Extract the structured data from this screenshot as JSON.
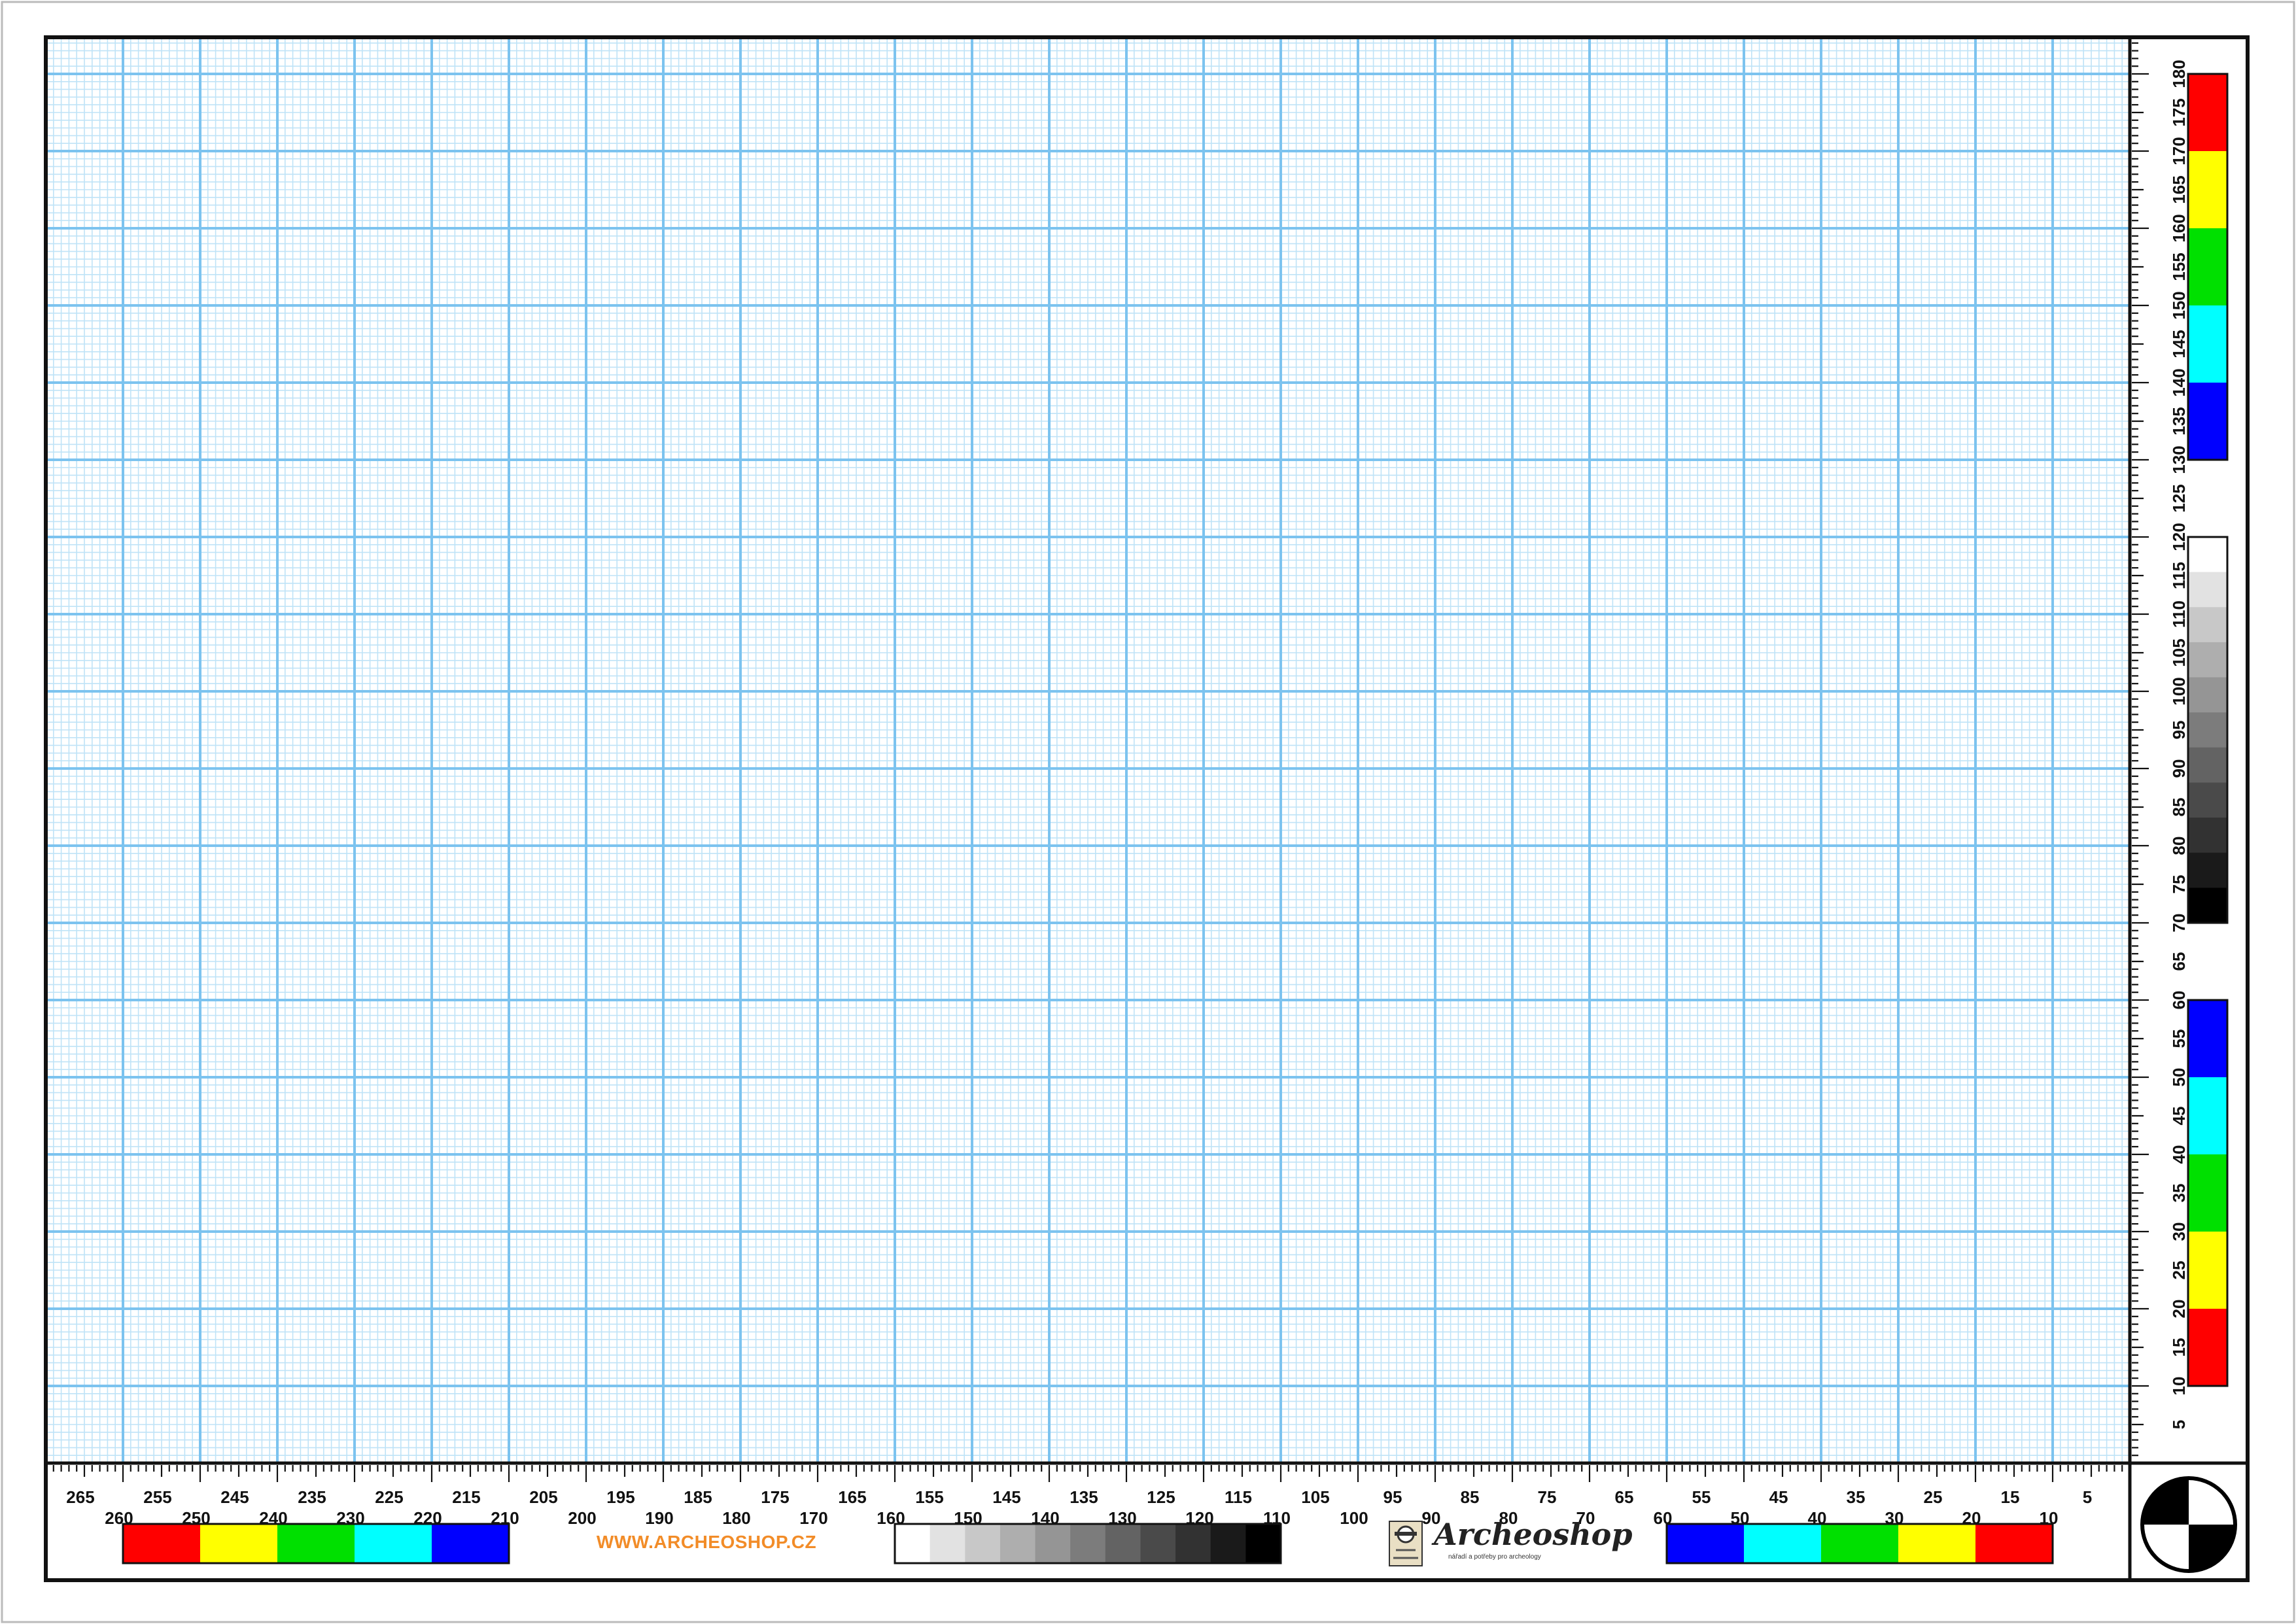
{
  "brand": {
    "name": "Archeoshop",
    "tagline": "nářadí a potřeby pro archeology",
    "website": "WWW.ARCHEOSHOP.CZ",
    "website_color": "#f28c28"
  },
  "grid": {
    "minor_color": "#bfe3f7",
    "major_color": "#7cc3ef",
    "minor_step_mm": 1,
    "major_step_mm": 10
  },
  "bottom_ruler": {
    "range_mm": [
      0,
      270
    ],
    "tick_labels_upper": [
      "265",
      "255",
      "245",
      "235",
      "225",
      "215",
      "205",
      "195",
      "185",
      "175",
      "165",
      "155",
      "145",
      "135",
      "125",
      "115",
      "105",
      "95",
      "85",
      "75",
      "65",
      "55",
      "45",
      "35",
      "25",
      "15",
      "5"
    ],
    "tick_labels_lower": [
      "260",
      "250",
      "240",
      "230",
      "220",
      "210",
      "200",
      "190",
      "180",
      "170",
      "160",
      "150",
      "140",
      "130",
      "120",
      "110",
      "100",
      "90",
      "80",
      "70",
      "60",
      "50",
      "40",
      "30",
      "20",
      "10"
    ]
  },
  "side_ruler": {
    "range_mm": [
      0,
      185
    ],
    "tick_labels": [
      "5",
      "10",
      "15",
      "20",
      "25",
      "30",
      "35",
      "40",
      "45",
      "50",
      "55",
      "60",
      "65",
      "70",
      "75",
      "80",
      "85",
      "90",
      "95",
      "100",
      "105",
      "110",
      "115",
      "120",
      "125",
      "130",
      "135",
      "140",
      "145",
      "150",
      "155",
      "160",
      "165",
      "170",
      "175",
      "180"
    ]
  },
  "color_scales": {
    "bottom_left": {
      "range_mm": [
        210,
        260
      ],
      "colors": [
        "#ff0000",
        "#ffff00",
        "#00e000",
        "#00ffff",
        "#0000ff"
      ]
    },
    "bottom_grayscale": {
      "range_mm": [
        110,
        160
      ],
      "colors": [
        "#ffffff",
        "#e2e2e2",
        "#c8c8c8",
        "#aeaeae",
        "#959595",
        "#7c7c7c",
        "#636363",
        "#4a4a4a",
        "#323232",
        "#1a1a1a",
        "#000000"
      ]
    },
    "bottom_right": {
      "range_mm": [
        10,
        60
      ],
      "colors": [
        "#0000ff",
        "#00ffff",
        "#00e000",
        "#ffff00",
        "#ff0000"
      ]
    },
    "side_top": {
      "range_mm": [
        130,
        180
      ],
      "colors": [
        "#ff0000",
        "#ffff00",
        "#00e000",
        "#00ffff",
        "#0000ff"
      ]
    },
    "side_grayscale": {
      "range_mm": [
        70,
        120
      ],
      "colors": [
        "#ffffff",
        "#e2e2e2",
        "#c8c8c8",
        "#aeaeae",
        "#959595",
        "#7c7c7c",
        "#636363",
        "#4a4a4a",
        "#323232",
        "#1a1a1a",
        "#000000"
      ]
    },
    "side_bottom": {
      "range_mm": [
        10,
        60
      ],
      "colors": [
        "#0000ff",
        "#00ffff",
        "#00e000",
        "#ffff00",
        "#ff0000"
      ]
    }
  },
  "target_marker": {
    "colors": [
      "#000000",
      "#ffffff"
    ]
  }
}
